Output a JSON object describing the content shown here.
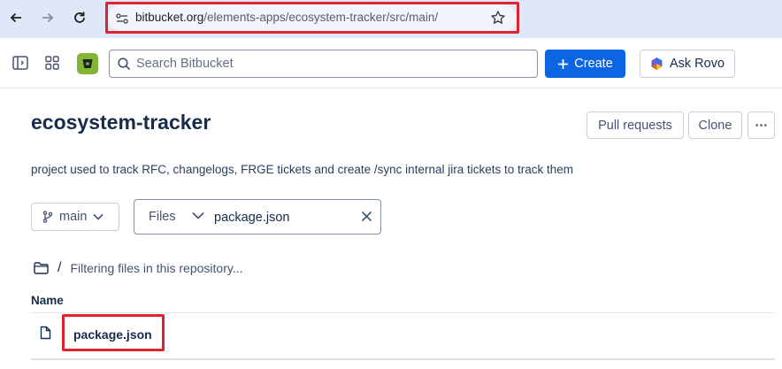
{
  "browser": {
    "url_host": "bitbucket.org",
    "url_path": "/elements-apps/ecosystem-tracker/src/main/",
    "highlight_color": "#e0242f"
  },
  "header": {
    "search_placeholder": "Search Bitbucket",
    "create_label": "Create",
    "rovo_label": "Ask Rovo",
    "accent": "#0c66e4"
  },
  "repo": {
    "title": "ecosystem-tracker",
    "pull_requests_label": "Pull requests",
    "clone_label": "Clone",
    "more_label": "⋯",
    "description": "project used to track RFC, changelogs, FRGE tickets and create /sync internal jira tickets to track them"
  },
  "filters": {
    "branch": "main",
    "files_label": "Files",
    "filter_value": "package.json"
  },
  "breadcrumb": {
    "separator": "/",
    "status": "Filtering files in this repository..."
  },
  "table": {
    "column_name": "Name",
    "rows": [
      {
        "name": "package.json",
        "icon": "file-icon"
      }
    ]
  }
}
